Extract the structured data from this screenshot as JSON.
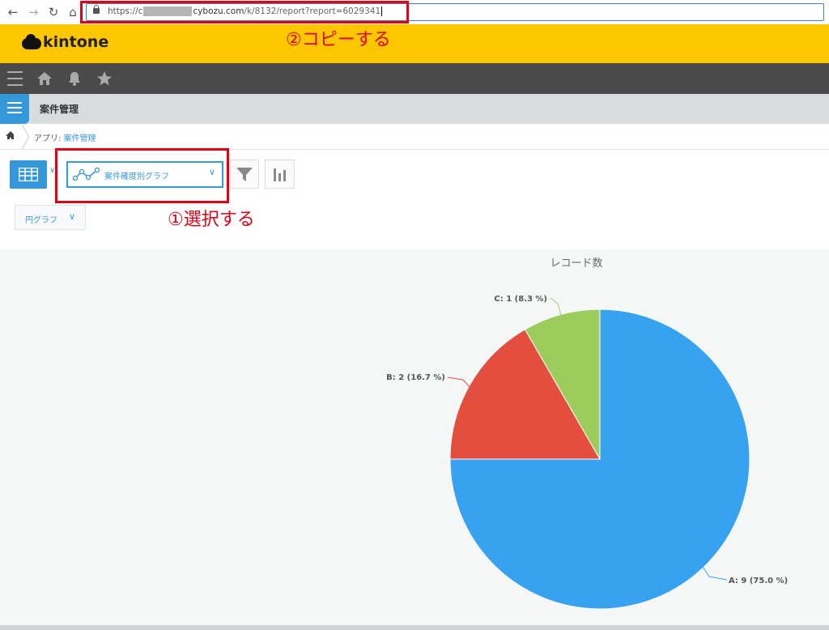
{
  "browser": {
    "url_scheme_host_prefix": "https://c",
    "url_host_suffix": "cybozu.com",
    "url_path": "/k/8132/report?report=6029341"
  },
  "annotations": {
    "copy_note": "②コピーする",
    "select_note": "①選択する",
    "accent": "#e60012"
  },
  "header": {
    "logo_text": "kintone",
    "brand_color": "#fcc600"
  },
  "nav": {
    "icons": [
      "menu-icon",
      "home-icon",
      "bell-icon",
      "star-icon"
    ]
  },
  "app": {
    "title": "案件管理"
  },
  "breadcrumb": {
    "prefix": "アプリ: ",
    "app_link": "案件管理"
  },
  "toolbar": {
    "report_select_label": "案件確度別グラフ",
    "chart_type_label": "円グラフ"
  },
  "chart_data": {
    "type": "pie",
    "title": "レコード数",
    "slices": [
      {
        "label": "A: 9 (75.0 %)",
        "category": "A",
        "value": 9,
        "percent": 75.0,
        "color": "#36a2f0"
      },
      {
        "label": "B: 2 (16.7 %)",
        "category": "B",
        "value": 2,
        "percent": 16.7,
        "color": "#e34e3e"
      },
      {
        "label": "C: 1 (8.3 %)",
        "category": "C",
        "value": 1,
        "percent": 8.3,
        "color": "#9ccc5c"
      }
    ],
    "start_angle": "12 o'clock",
    "direction": "clockwise"
  }
}
